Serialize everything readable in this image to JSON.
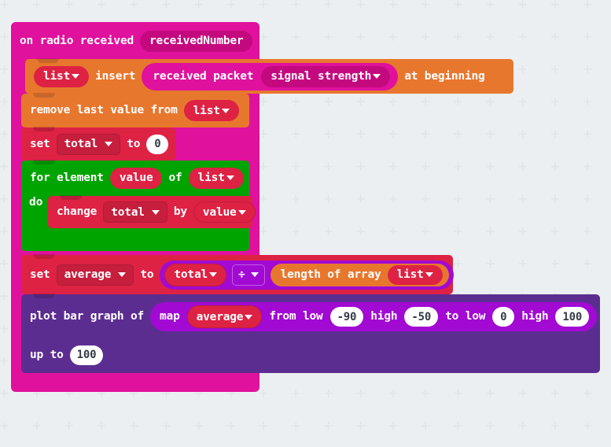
{
  "workspace": {
    "background_color": "#eceff1",
    "grid_color": "#dfe3e5"
  },
  "palette": {
    "radio": "#e0119d",
    "arrays": "#e8772e",
    "variables": "#dd2244",
    "loops": "#00a400",
    "led": "#5c2d91",
    "math": "#a209d3",
    "radio_field": "#c4097f"
  },
  "program": {
    "hat": {
      "label": "on radio received",
      "parameter": "receivedNumber"
    },
    "insert_block": {
      "list_field": "list",
      "insert_label": "insert",
      "received_packet_label": "received packet",
      "packet_property": "signal strength",
      "at_beginning_label": "at beginning"
    },
    "remove_block": {
      "label": "remove last value from",
      "list_field": "list"
    },
    "set_total_block": {
      "set_label": "set",
      "variable": "total",
      "to_label": "to",
      "value": "0"
    },
    "for_element_block": {
      "for_element_label": "for element",
      "element_var": "value",
      "of_label": "of",
      "list_field": "list",
      "do_label": "do",
      "body": {
        "change_label": "change",
        "variable": "total",
        "by_label": "by",
        "value_var": "value"
      }
    },
    "set_average_block": {
      "set_label": "set",
      "variable": "average",
      "to_label": "to",
      "math": {
        "left_operand": "total",
        "operator": "÷",
        "right": {
          "label": "length of array",
          "list_field": "list"
        }
      }
    },
    "plot_block": {
      "label": "plot bar graph of",
      "map": {
        "map_label": "map",
        "value_var": "average",
        "from_low_label": "from low",
        "from_low": "-90",
        "from_high_label": "high",
        "from_high": "-50",
        "to_low_label": "to low",
        "to_low": "0",
        "to_high_label": "high",
        "to_high": "100"
      },
      "up_to_label": "up to",
      "up_to": "100"
    }
  }
}
